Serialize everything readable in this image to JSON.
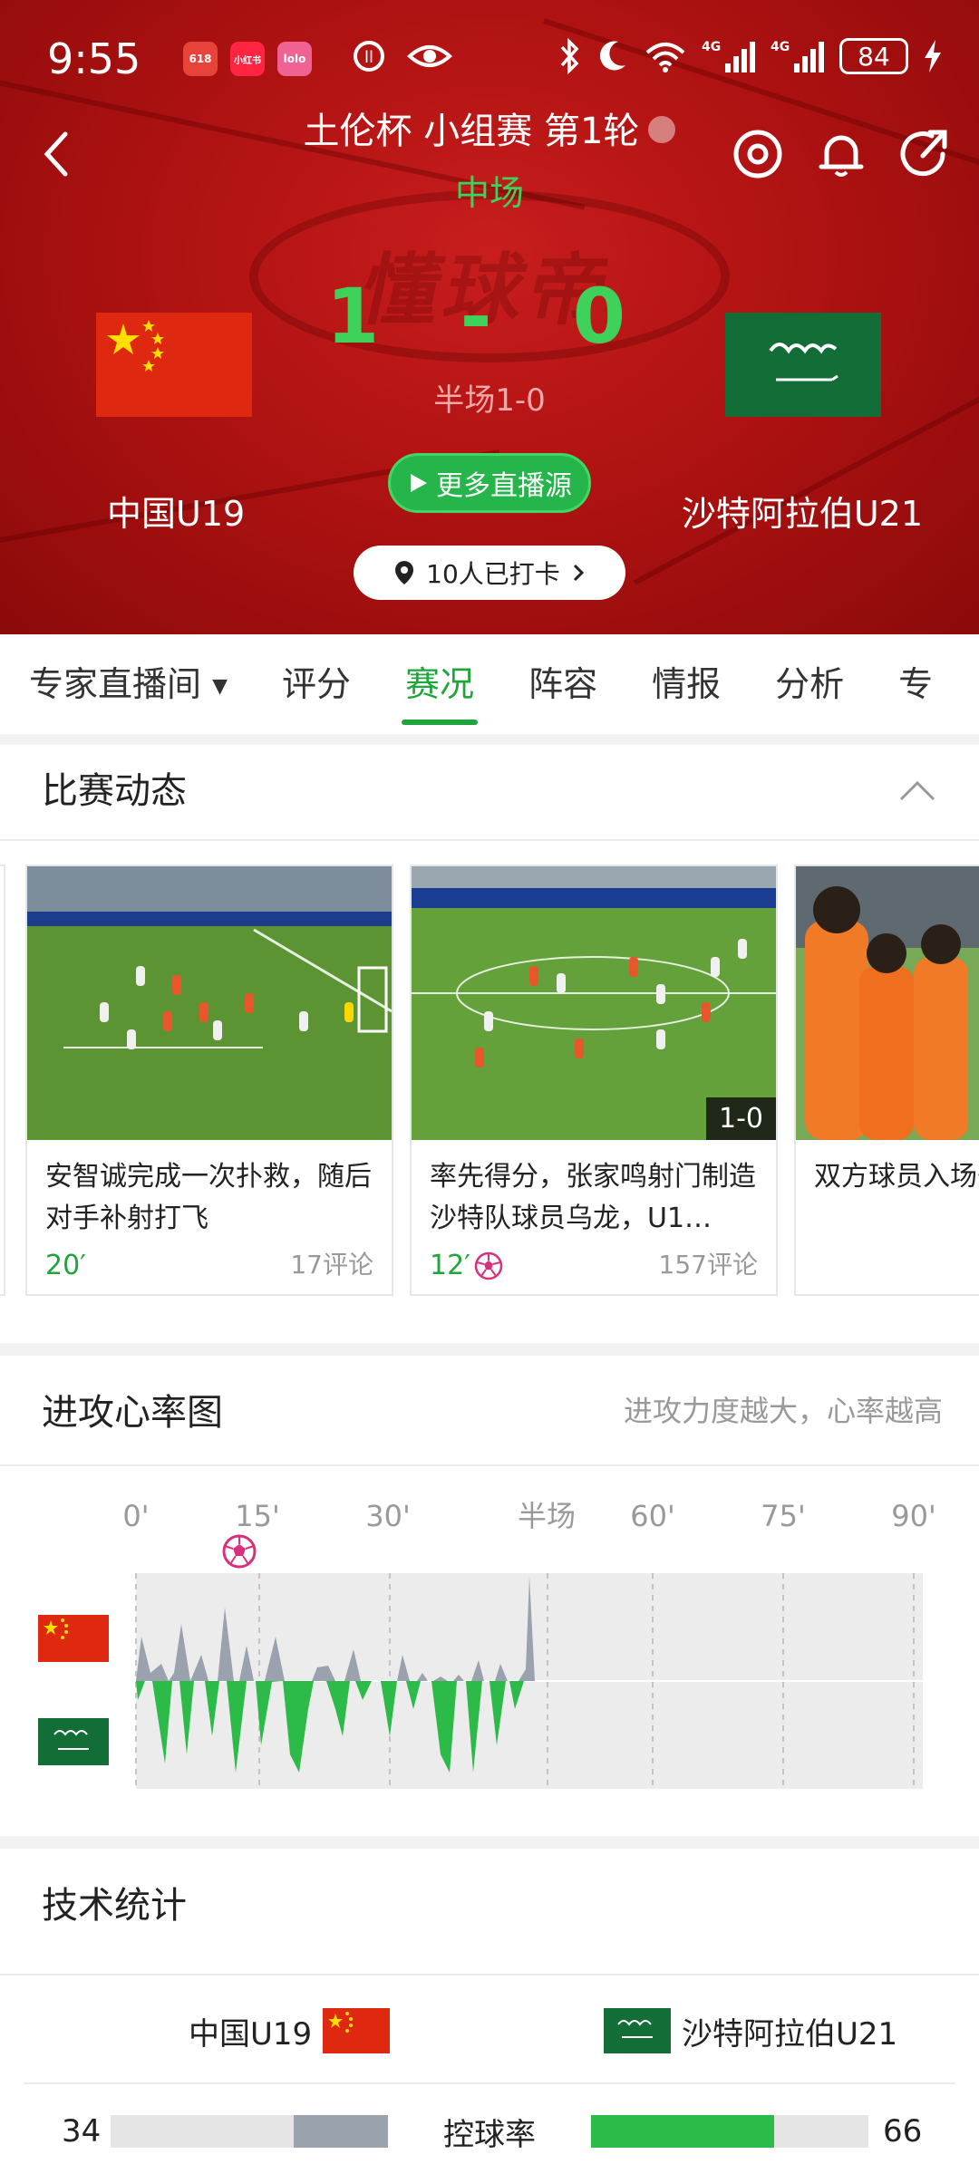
{
  "status_bar": {
    "time": "9:55",
    "apps": [
      {
        "label": "618",
        "color": "#e8433b"
      },
      {
        "label": "小红书",
        "color": "#ff2442"
      },
      {
        "label": "lolo",
        "color": "#f06292"
      }
    ],
    "battery": "84",
    "network": [
      "4G",
      "4G"
    ]
  },
  "header": {
    "title": "土伦杯 小组赛 第1轮",
    "phase": "中场",
    "score": "1 - 0",
    "half_score": "半场1-0",
    "home_team": "中国U19",
    "away_team": "沙特阿拉伯U21",
    "live_button": "更多直播源",
    "checkin": "10人已打卡",
    "watermark": "懂球帝"
  },
  "tabs": [
    {
      "label": "专家直播间",
      "active": false
    },
    {
      "label": "评分",
      "active": false
    },
    {
      "label": "赛况",
      "active": true
    },
    {
      "label": "阵容",
      "active": false
    },
    {
      "label": "情报",
      "active": false
    },
    {
      "label": "分析",
      "active": false
    },
    {
      "label": "专",
      "active": false
    }
  ],
  "match_events": {
    "title": "比赛动态",
    "videos": [
      {
        "caption": "安智诚完成一次扑救，随后对手补射打飞",
        "minute": "20′",
        "comments": "17评论",
        "goal": false,
        "score_tag": ""
      },
      {
        "caption": "率先得分，张家鸣射门制造沙特队球员乌龙，U1…",
        "minute": "12′",
        "comments": "157评论",
        "goal": true,
        "score_tag": "1-0"
      },
      {
        "caption": "双方球员入场开始",
        "minute": "",
        "comments": "",
        "goal": false,
        "score_tag": ""
      }
    ]
  },
  "heart_rate": {
    "title": "进攻心率图",
    "hint": "进攻力度越大，心率越高",
    "ticks": [
      "0'",
      "15'",
      "30'",
      "半场",
      "60'",
      "75'",
      "90'"
    ],
    "goal_minute": 12
  },
  "tech_stats": {
    "title": "技术统计",
    "home_team": "中国U19",
    "away_team": "沙特阿拉伯U21",
    "rows": [
      {
        "label": "控球率",
        "home": "34",
        "away": "66"
      }
    ]
  },
  "colors": {
    "accent_green": "#1fa53c",
    "home_bar": "#9aa2ad",
    "away_bar": "#2cbb48",
    "header_red": "#b01212"
  }
}
